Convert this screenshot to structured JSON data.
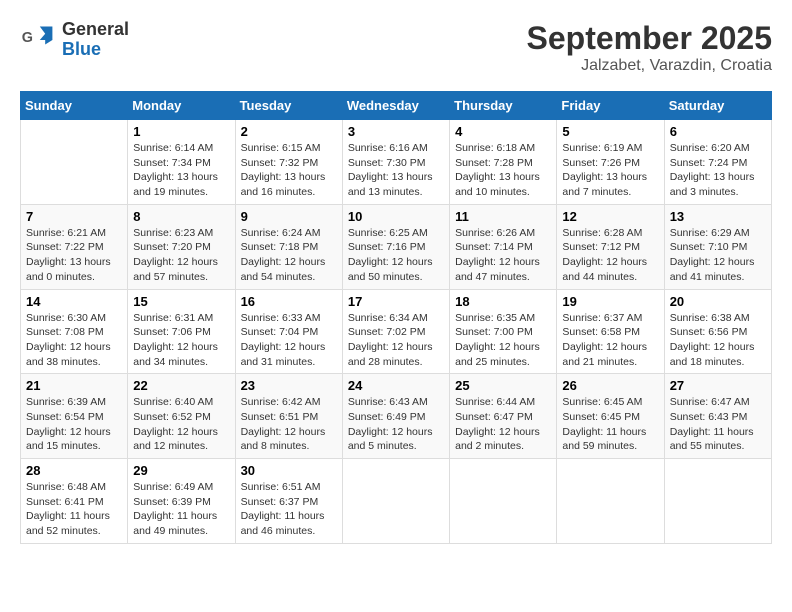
{
  "logo": {
    "general": "General",
    "blue": "Blue"
  },
  "header": {
    "month": "September 2025",
    "location": "Jalzabet, Varazdin, Croatia"
  },
  "days_of_week": [
    "Sunday",
    "Monday",
    "Tuesday",
    "Wednesday",
    "Thursday",
    "Friday",
    "Saturday"
  ],
  "weeks": [
    [
      {
        "day": "",
        "info": ""
      },
      {
        "day": "1",
        "info": "Sunrise: 6:14 AM\nSunset: 7:34 PM\nDaylight: 13 hours\nand 19 minutes."
      },
      {
        "day": "2",
        "info": "Sunrise: 6:15 AM\nSunset: 7:32 PM\nDaylight: 13 hours\nand 16 minutes."
      },
      {
        "day": "3",
        "info": "Sunrise: 6:16 AM\nSunset: 7:30 PM\nDaylight: 13 hours\nand 13 minutes."
      },
      {
        "day": "4",
        "info": "Sunrise: 6:18 AM\nSunset: 7:28 PM\nDaylight: 13 hours\nand 10 minutes."
      },
      {
        "day": "5",
        "info": "Sunrise: 6:19 AM\nSunset: 7:26 PM\nDaylight: 13 hours\nand 7 minutes."
      },
      {
        "day": "6",
        "info": "Sunrise: 6:20 AM\nSunset: 7:24 PM\nDaylight: 13 hours\nand 3 minutes."
      }
    ],
    [
      {
        "day": "7",
        "info": "Sunrise: 6:21 AM\nSunset: 7:22 PM\nDaylight: 13 hours\nand 0 minutes."
      },
      {
        "day": "8",
        "info": "Sunrise: 6:23 AM\nSunset: 7:20 PM\nDaylight: 12 hours\nand 57 minutes."
      },
      {
        "day": "9",
        "info": "Sunrise: 6:24 AM\nSunset: 7:18 PM\nDaylight: 12 hours\nand 54 minutes."
      },
      {
        "day": "10",
        "info": "Sunrise: 6:25 AM\nSunset: 7:16 PM\nDaylight: 12 hours\nand 50 minutes."
      },
      {
        "day": "11",
        "info": "Sunrise: 6:26 AM\nSunset: 7:14 PM\nDaylight: 12 hours\nand 47 minutes."
      },
      {
        "day": "12",
        "info": "Sunrise: 6:28 AM\nSunset: 7:12 PM\nDaylight: 12 hours\nand 44 minutes."
      },
      {
        "day": "13",
        "info": "Sunrise: 6:29 AM\nSunset: 7:10 PM\nDaylight: 12 hours\nand 41 minutes."
      }
    ],
    [
      {
        "day": "14",
        "info": "Sunrise: 6:30 AM\nSunset: 7:08 PM\nDaylight: 12 hours\nand 38 minutes."
      },
      {
        "day": "15",
        "info": "Sunrise: 6:31 AM\nSunset: 7:06 PM\nDaylight: 12 hours\nand 34 minutes."
      },
      {
        "day": "16",
        "info": "Sunrise: 6:33 AM\nSunset: 7:04 PM\nDaylight: 12 hours\nand 31 minutes."
      },
      {
        "day": "17",
        "info": "Sunrise: 6:34 AM\nSunset: 7:02 PM\nDaylight: 12 hours\nand 28 minutes."
      },
      {
        "day": "18",
        "info": "Sunrise: 6:35 AM\nSunset: 7:00 PM\nDaylight: 12 hours\nand 25 minutes."
      },
      {
        "day": "19",
        "info": "Sunrise: 6:37 AM\nSunset: 6:58 PM\nDaylight: 12 hours\nand 21 minutes."
      },
      {
        "day": "20",
        "info": "Sunrise: 6:38 AM\nSunset: 6:56 PM\nDaylight: 12 hours\nand 18 minutes."
      }
    ],
    [
      {
        "day": "21",
        "info": "Sunrise: 6:39 AM\nSunset: 6:54 PM\nDaylight: 12 hours\nand 15 minutes."
      },
      {
        "day": "22",
        "info": "Sunrise: 6:40 AM\nSunset: 6:52 PM\nDaylight: 12 hours\nand 12 minutes."
      },
      {
        "day": "23",
        "info": "Sunrise: 6:42 AM\nSunset: 6:51 PM\nDaylight: 12 hours\nand 8 minutes."
      },
      {
        "day": "24",
        "info": "Sunrise: 6:43 AM\nSunset: 6:49 PM\nDaylight: 12 hours\nand 5 minutes."
      },
      {
        "day": "25",
        "info": "Sunrise: 6:44 AM\nSunset: 6:47 PM\nDaylight: 12 hours\nand 2 minutes."
      },
      {
        "day": "26",
        "info": "Sunrise: 6:45 AM\nSunset: 6:45 PM\nDaylight: 11 hours\nand 59 minutes."
      },
      {
        "day": "27",
        "info": "Sunrise: 6:47 AM\nSunset: 6:43 PM\nDaylight: 11 hours\nand 55 minutes."
      }
    ],
    [
      {
        "day": "28",
        "info": "Sunrise: 6:48 AM\nSunset: 6:41 PM\nDaylight: 11 hours\nand 52 minutes."
      },
      {
        "day": "29",
        "info": "Sunrise: 6:49 AM\nSunset: 6:39 PM\nDaylight: 11 hours\nand 49 minutes."
      },
      {
        "day": "30",
        "info": "Sunrise: 6:51 AM\nSunset: 6:37 PM\nDaylight: 11 hours\nand 46 minutes."
      },
      {
        "day": "",
        "info": ""
      },
      {
        "day": "",
        "info": ""
      },
      {
        "day": "",
        "info": ""
      },
      {
        "day": "",
        "info": ""
      }
    ]
  ]
}
